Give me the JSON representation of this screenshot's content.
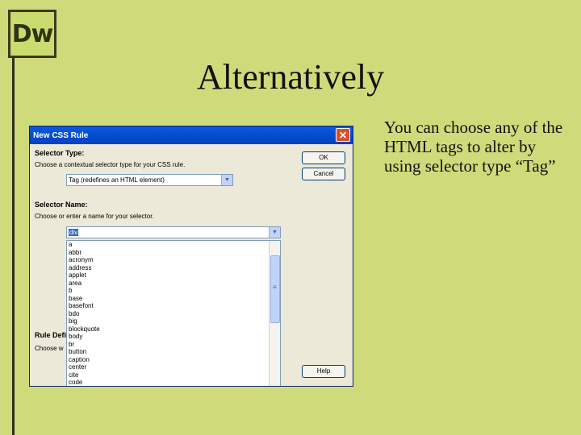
{
  "slide": {
    "logo": "Dw",
    "title": "Alternatively",
    "body": "You can choose any of the HTML tags to alter by using selector type “Tag”"
  },
  "dialog": {
    "title": "New CSS Rule",
    "selector_type_label": "Selector Type:",
    "selector_type_help": "Choose a contextual selector type for your CSS rule.",
    "selector_type_value": "Tag (redefines an HTML element)",
    "selector_name_label": "Selector Name:",
    "selector_name_help": "Choose or enter a name for your selector.",
    "selector_name_value": "div",
    "tag_options": [
      "a",
      "abbr",
      "acronym",
      "address",
      "applet",
      "area",
      "b",
      "base",
      "basefont",
      "bdo",
      "big",
      "blockquote",
      "body",
      "br",
      "button",
      "caption",
      "center",
      "cite",
      "code"
    ],
    "rule_def_label": "Rule Defi",
    "rule_def_help": "Choose w",
    "ok_label": "OK",
    "cancel_label": "Cancel",
    "help_label": "Help"
  }
}
